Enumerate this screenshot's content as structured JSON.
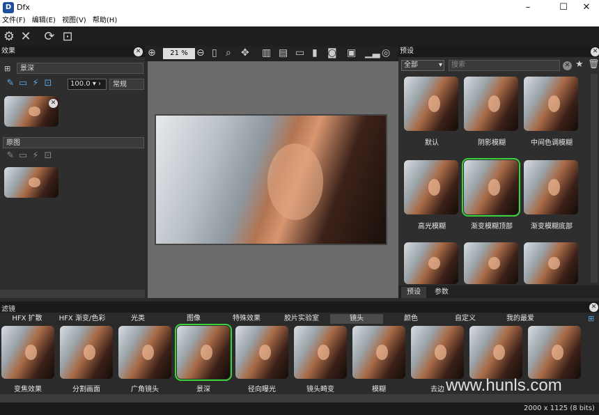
{
  "window": {
    "title": "Dfx",
    "icon": "dfx-logo-icon",
    "buttons": [
      "–",
      "☐",
      "✕"
    ]
  },
  "menu": [
    "文件(F)",
    "编辑(E)",
    "视图(V)",
    "帮助(H)"
  ],
  "toolbar": {
    "zoom": "21 %"
  },
  "effects": {
    "title": "效果",
    "layer": "景深",
    "amount": "100.0",
    "blend": "常规",
    "original": "原图"
  },
  "presets": {
    "title": "预设",
    "filter": "全部",
    "search_placeholder": "搜索",
    "labels": [
      "默认",
      "阴影模糊",
      "中间色调模糊",
      "高光模糊",
      "渐变模糊顶部",
      "渐变模糊底部"
    ],
    "tabs": [
      "预设",
      "参数"
    ]
  },
  "filters": {
    "title": "滤镜",
    "categories": [
      "HFX 扩散",
      "HFX 渐变/色彩",
      "光类",
      "图像",
      "特殊效果",
      "胶片实验室",
      "镜头",
      "颜色",
      "自定义",
      "我的最爱"
    ],
    "labels": [
      "变焦效果",
      "分割画面",
      "广角镜头",
      "景深",
      "径向曝光",
      "镜头畸变",
      "模糊",
      "去边"
    ]
  },
  "watermark": "www.hunls.com",
  "status": "2000 x 1125 (8 bits)",
  "colors": {
    "accent": "#3ad33a",
    "icon_blue": "#5aa9e6"
  }
}
